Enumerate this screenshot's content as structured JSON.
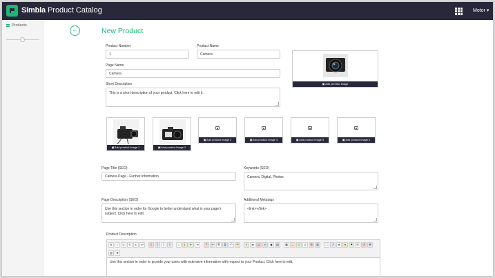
{
  "app": {
    "brand_primary": "Simbla",
    "brand_secondary": "Product Catalog",
    "user_label": "Motor ▾",
    "accent_color": "#1fb574",
    "topbar_color": "#27293a"
  },
  "sidebar": {
    "items": [
      {
        "label": "Products",
        "icon": "list-icon"
      }
    ]
  },
  "page": {
    "title": "New Product",
    "back_icon": "arrow-left-icon"
  },
  "form": {
    "product_number": {
      "label": "Product Number",
      "value": "1"
    },
    "product_name": {
      "label": "Product Name",
      "value": "Camera"
    },
    "page_name": {
      "label": "Page Name",
      "value": "Camera"
    },
    "short_description": {
      "label": "Short Description",
      "value": "This is a short description of your product. Click here to edit it."
    },
    "preview_image": {
      "button": "▣ Add preview image"
    },
    "product_images": [
      {
        "button": "▣ Add product image 1",
        "has_image": true
      },
      {
        "button": "▣ Add product image 2",
        "has_image": true
      },
      {
        "button": "▣ Add product image 3",
        "has_image": false
      },
      {
        "button": "▣ Add product image 4",
        "has_image": false
      },
      {
        "button": "▣ Add product image 5",
        "has_image": false
      },
      {
        "button": "▣ Add product image 6",
        "has_image": false
      }
    ],
    "page_title_seo": {
      "label": "Page Title (SEO)",
      "value": "Camera Page - Further Information"
    },
    "keywords_seo": {
      "label": "Keywords (SEO)",
      "value": "Camera, Digital, Photos"
    },
    "page_description_seo": {
      "label": "Page Description (SEO)",
      "value": "Use this section in order for Google to better understand what is your page's subject. Click here to edit."
    },
    "additional_metatags": {
      "label": "Additional Metatags",
      "value": "<link></link>"
    },
    "product_description": {
      "label": "Product Description",
      "value": "Use this section in order to provide your users with extensive information with respect to your Product. Click here to edit."
    }
  },
  "editor_toolbar": {
    "row1": [
      "B",
      "I",
      "U",
      "S",
      "x₂",
      "x²",
      "≡",
      "≡",
      "≡",
      "≡",
      "•",
      "1.",
      "⇤",
      "⇥",
      "❝",
      "✂",
      "⎘",
      "⎙",
      "↶",
      "↷",
      "⌕",
      "⇄",
      "☑",
      "◎",
      "▣",
      "▤",
      "▦",
      "—",
      "☺",
      "Ω",
      "☰",
      "▥",
      "⬚",
      "↗",
      "★",
      "♦",
      "⚑",
      "✉",
      "↺",
      "⌘"
    ],
    "row2": [
      "▧",
      "✥"
    ]
  }
}
